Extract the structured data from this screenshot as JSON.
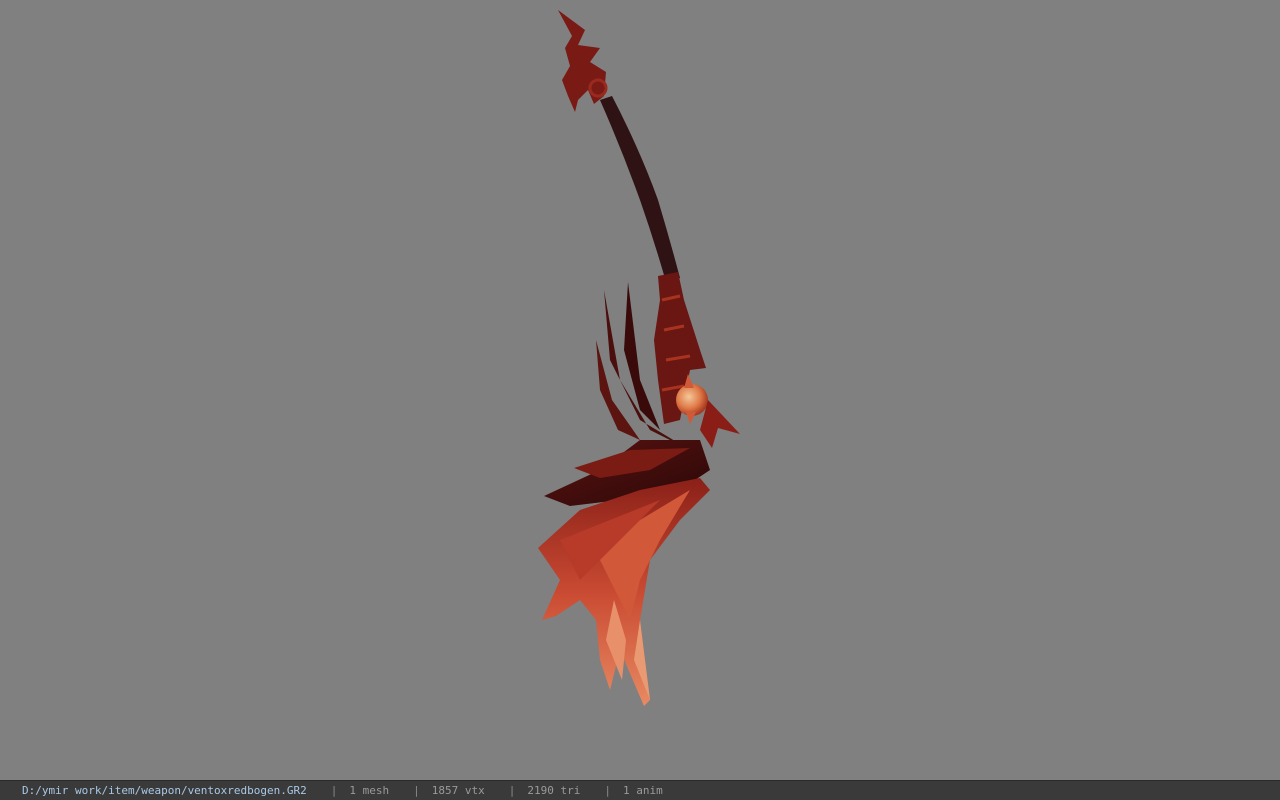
{
  "viewport": {
    "background": "#808080",
    "model_name": "ventoxredbogen"
  },
  "statusbar": {
    "file_path": "D:/ymir work/item/weapon/ventoxredbogen.GR2",
    "separator": "|",
    "mesh_count": "1 mesh",
    "vertex_count": "1857 vtx",
    "triangle_count": "2190 tri",
    "anim_count": "1 anim"
  }
}
